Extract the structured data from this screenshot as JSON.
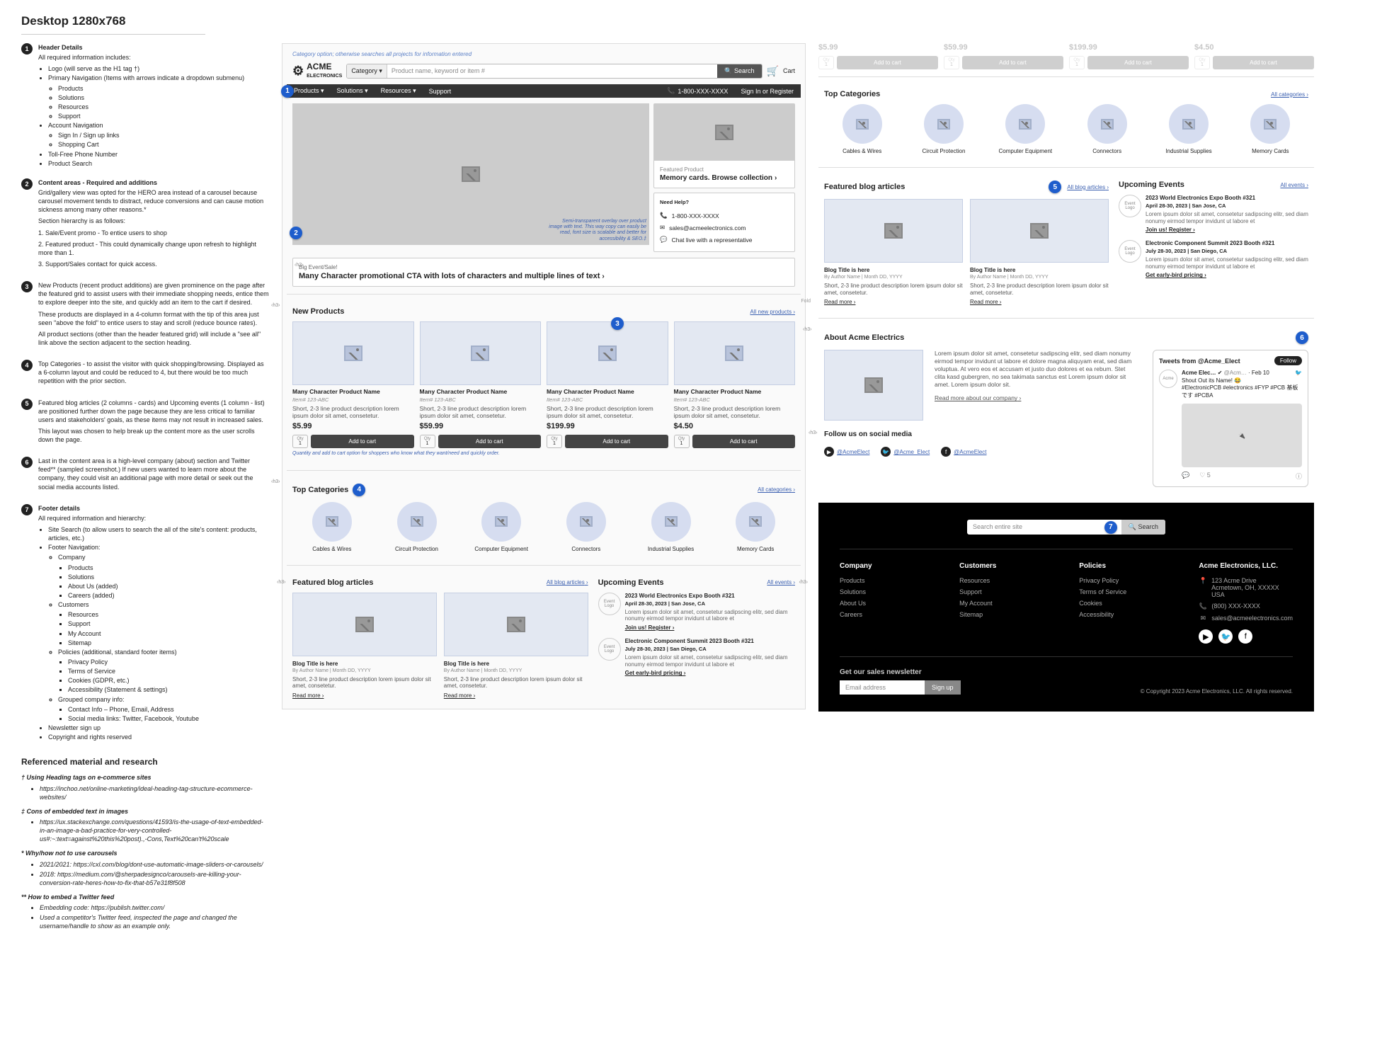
{
  "page_title": "Desktop 1280x768",
  "annotations": [
    {
      "n": "1",
      "title": "Header Details",
      "body": "All required information includes:",
      "bullets": [
        "Logo (will serve as the H1 tag †)",
        "Primary Navigation (Items with arrows indicate a dropdown submenu)",
        [
          "Products",
          "Solutions",
          "Resources",
          "Support"
        ],
        "Account Navigation",
        [
          "Sign In / Sign up links",
          "Shopping Cart"
        ],
        "Toll-Free Phone Number",
        "Product Search"
      ]
    },
    {
      "n": "2",
      "title": "Content areas - Required and additions",
      "body": "Grid/gallery view was opted for the HERO area instead of a carousel because carousel movement tends to distract, reduce conversions and can cause motion sickness among many other reasons.*\nSection hierarchy is as follows:\n1. Sale/Event promo - To entice users to shop\n2. Featured product - This could dynamically change upon refresh to highlight more than 1.\n3. Support/Sales contact for quick access."
    },
    {
      "n": "3",
      "title": "",
      "body": "New Products (recent product additions) are given prominence on the page after the featured grid to assist users with their immediate shopping needs, entice them to explore deeper into the site, and quickly add an item to the cart if desired.\n\nThese products are displayed in a 4-column format with the tip of this area just seen \"above the fold\" to entice users to stay and scroll (reduce bounce rates).\n\nAll product sections (other than the header featured grid) will include a \"see all\" link above the section adjacent to the section heading."
    },
    {
      "n": "4",
      "title": "",
      "body": "Top Categories - to assist the visitor with quick shopping/browsing. Displayed as a 6-column layout and could be reduced to 4, but there would be too much repetition with the prior section."
    },
    {
      "n": "5",
      "title": "",
      "body": "Featured blog articles (2 columns - cards) and Upcoming events (1 column - list) are positioned further down the page because they are less critical to familiar users and stakeholders' goals, as these items may not result in increased sales.\n\nThis layout was chosen to help break up the content more as the user scrolls down the page."
    },
    {
      "n": "6",
      "title": "",
      "body": "Last in the content area is a high-level company (about) section and Twitter feed** (sampled screenshot.) If new users wanted to learn more about the company, they could visit an additional page with more detail or seek out the social media accounts listed."
    },
    {
      "n": "7",
      "title": "Footer details",
      "body": "All required information and hierarchy:",
      "bullets": [
        "Site Search (to allow users to search the all of the site's content: products, articles, etc.)",
        "Footer Navigation:",
        [
          "Company",
          [
            "Products",
            "Solutions",
            "About Us (added)",
            "Careers (added)"
          ],
          "Customers",
          [
            "Resources",
            "Support",
            "My Account",
            "Sitemap"
          ],
          "Policies (additional, standard footer items)",
          [
            "Privacy Policy",
            "Terms of Service",
            "Cookies (GDPR, etc.)",
            "Accessibility (Statement & settings)"
          ],
          "Grouped company info:",
          [
            "Contact Info – Phone, Email, Address",
            "Social media links: Twitter, Facebook, Youtube"
          ]
        ],
        "Newsletter sign up",
        "Copyright and rights reserved"
      ]
    }
  ],
  "references": {
    "heading": "Referenced material and research",
    "groups": [
      {
        "title": "† Using Heading tags on e-commerce sites",
        "items": [
          "https://inchoo.net/online-marketing/ideal-heading-tag-structure-ecommerce-websites/"
        ]
      },
      {
        "title": "‡ Cons of embedded text in images",
        "items": [
          "https://ux.stackexchange.com/questions/41593/is-the-usage-of-text-embedded-in-an-image-a-bad-practice-for-very-controlled-us#:~:text=against%20this%20post).,-Cons,Text%20can't%20scale"
        ]
      },
      {
        "title": "* Why/how not to use carousels",
        "items": [
          "2021/2021: https://cxl.com/blog/dont-use-automatic-image-sliders-or-carousels/",
          "2018: https://medium.com/@sherpadesignco/carousels-are-killing-your-conversion-rate-heres-how-to-fix-that-b57e31f8f508"
        ]
      },
      {
        "title": "** How to embed a Twitter feed",
        "items": [
          "Embedding code: https://publish.twitter.com/",
          "Used a competitor's Twitter feed, inspected the page and changed the username/handle to show as an example only."
        ]
      }
    ]
  },
  "header": {
    "topbar_note": "Category option; otherwise searches all projects for information entered",
    "logo_top": "ACME",
    "logo_bottom": "ELECTRONICS",
    "category_label": "Category ▾",
    "search_placeholder": "Product name, keyword or item #",
    "search_btn": "Search",
    "cart": "Cart",
    "nav": [
      "Products ▾",
      "Solutions ▾",
      "Resources ▾",
      "Support"
    ],
    "phone": "1-800-XXX-XXXX",
    "signin": "Sign In or Register"
  },
  "hero": {
    "overlay": "Semi-transparent overlay over product image with text. This way copy can easily be read, font size is scalable and better for accessibility & SEO.‡",
    "featured_label": "Featured Product",
    "featured_title": "Memory cards. Browse collection",
    "need_help": "Need Help?",
    "nh_phone": "1-800-XXX-XXXX",
    "nh_email": "sales@acmeelectronics.com",
    "nh_chat": "Chat live with a representative",
    "event_label": "Big Event/Sale!",
    "event_cta": "Many Character promotional CTA with lots of characters and  multiple lines of text"
  },
  "new_products": {
    "title": "New Products",
    "link": "All new products",
    "note": "Quantity and add to cart option for shoppers who know what they want/need and quickly order.",
    "items": [
      {
        "name": "Many Character Product Name",
        "sku": "Item# 123-ABC",
        "desc": "Short, 2-3 line product description lorem ipsum dolor sit amet, consetetur.",
        "price": "$5.99"
      },
      {
        "name": "Many Character Product Name",
        "sku": "Item# 123-ABC",
        "desc": "Short, 2-3 line product description lorem ipsum dolor sit amet, consetetur.",
        "price": "$59.99"
      },
      {
        "name": "Many Character Product Name",
        "sku": "Item# 123-ABC",
        "desc": "Short, 2-3 line product description lorem ipsum dolor sit amet, consetetur.",
        "price": "$199.99"
      },
      {
        "name": "Many Character Product Name",
        "sku": "Item# 123-ABC",
        "desc": "Short, 2-3 line product description lorem ipsum dolor sit amet, consetetur.",
        "price": "$4.50"
      }
    ],
    "qty_lbl": "Qty",
    "qty_val": "1",
    "add_btn": "Add to cart"
  },
  "cont_products": {
    "prices": [
      "$5.99",
      "$59.99",
      "$199.99",
      "$4.50"
    ]
  },
  "top_categories": {
    "title": "Top Categories",
    "link": "All categories",
    "items": [
      "Cables & Wires",
      "Circuit Protection",
      "Computer Equipment",
      "Connectors",
      "Industrial Supplies",
      "Memory Cards"
    ]
  },
  "blogs": {
    "title": "Featured blog articles",
    "link": "All blog articles",
    "items": [
      {
        "title": "Blog Title is here",
        "meta": "By Author Name  |  Month DD, YYYY",
        "desc": "Short, 2-3 line product description lorem ipsum dolor sit amet, consetetur.",
        "read": "Read more"
      },
      {
        "title": "Blog Title is here",
        "meta": "By Author Name  |  Month DD, YYYY",
        "desc": "Short, 2-3 line product description lorem ipsum dolor sit amet, consetetur.",
        "read": "Read more"
      }
    ]
  },
  "events": {
    "title": "Upcoming Events",
    "link": "All events",
    "items": [
      {
        "logo": "Event Logo",
        "title": "2023 World Electronics Expo Booth #321",
        "meta": "April 28-30, 2023  |  San Jose, CA",
        "desc": "Lorem ipsum dolor sit amet, consetetur sadipscing elitr, sed diam nonumy eirmod tempor invidunt ut labore et",
        "link": "Join us!  Register"
      },
      {
        "logo": "Event Logo",
        "title": "Electronic Component Summit 2023 Booth #321",
        "meta": "July 28-30, 2023  |  San Diego, CA",
        "desc": "Lorem ipsum dolor sit amet, consetetur sadipscing elitr, sed diam nonumy eirmod tempor invidunt ut labore et",
        "link": "Get early-bird pricing"
      }
    ]
  },
  "about": {
    "title": "About Acme Electrics",
    "text": "Lorem ipsum dolor sit amet, consetetur sadipscing elitr, sed diam nonumy eirmod tempor invidunt ut labore et dolore magna aliquyam erat, sed diam voluptua. At vero eos et accusam et justo duo dolores et ea rebum. Stet clita kasd gubergren, no sea takimata sanctus est Lorem ipsum dolor sit amet. Lorem ipsum dolor sit.",
    "link": "Read more about our company",
    "follow": "Follow us on social media",
    "socials": [
      {
        "ico": "▶",
        "name": "@AcmeElect"
      },
      {
        "ico": "🐦",
        "name": "@Acme_Elect"
      },
      {
        "ico": "f",
        "name": "@AcmeElect"
      }
    ]
  },
  "tweet": {
    "header": "Tweets from @Acme_Elect",
    "follow": "Follow",
    "name": "Acme Elec…",
    "handle": "@Acm…",
    "date": "Feb 10",
    "text": "Shout Out its Name! 😂\n#ElectronicPCB #electronics #FYP #PCB 基板です #PCBA",
    "likes": "5"
  },
  "footer": {
    "search_placeholder": "Search entire site",
    "search_btn": "Search",
    "cols": [
      {
        "title": "Company",
        "items": [
          "Products",
          "Solutions",
          "About Us",
          "Careers"
        ]
      },
      {
        "title": "Customers",
        "items": [
          "Resources",
          "Support",
          "My Account",
          "Sitemap"
        ]
      },
      {
        "title": "Policies",
        "items": [
          "Privacy Policy",
          "Terms of Service",
          "Cookies",
          "Accessibility"
        ]
      }
    ],
    "company": "Acme Electronics, LLC.",
    "address": "123 Acme Drive\nAcmetown, OH, XXXXX USA",
    "phone": "(800) XXX-XXXX",
    "email": "sales@acmeelectronics.com",
    "newsletter_title": "Get our sales newsletter",
    "nl_placeholder": "Email address",
    "nl_btn": "Sign up",
    "copyright": "© Copyright 2023 Acme Electronics, LLC. All rights reserved."
  }
}
